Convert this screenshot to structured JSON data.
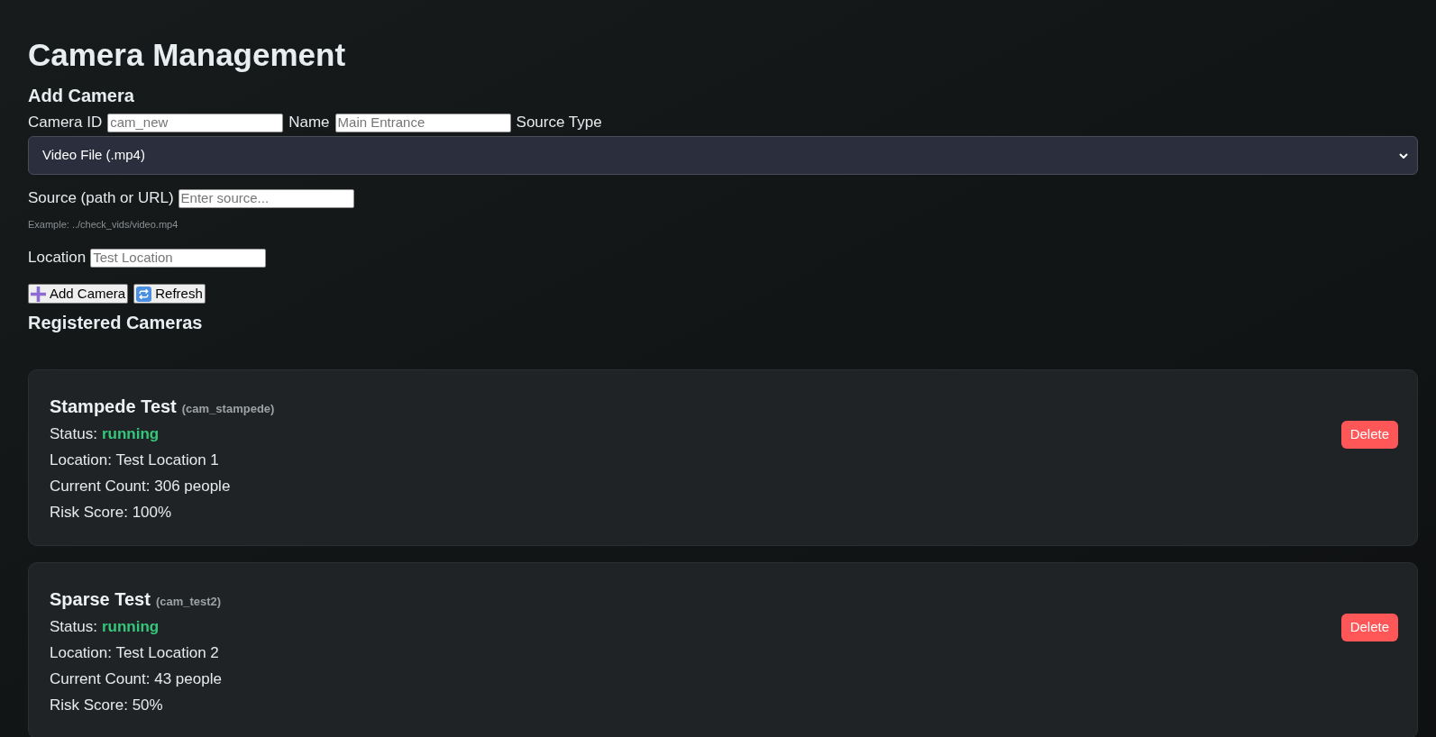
{
  "title": "Camera Management",
  "add_camera": {
    "heading": "Add Camera",
    "camera_id": {
      "label": "Camera ID",
      "placeholder": "cam_new"
    },
    "name": {
      "label": "Name",
      "placeholder": "Main Entrance"
    },
    "source_type": {
      "label": "Source Type",
      "value": "Video File (.mp4)"
    },
    "source": {
      "label": "Source (path or URL)",
      "placeholder": "Enter source...",
      "hint": "Example: ../check_vids/video.mp4"
    },
    "location": {
      "label": "Location",
      "placeholder": "Test Location"
    },
    "buttons": [
      {
        "kind": "add",
        "label": "Add Camera"
      },
      {
        "kind": "refresh",
        "label": "Refresh"
      }
    ]
  },
  "registered_cameras": {
    "heading": "Registered Cameras",
    "cameras": [
      {
        "name": "Stampede Test",
        "id": "(cam_stampede)",
        "status_label": "Status:",
        "status": "running",
        "location": "Location: Test Location 1",
        "count": "Current Count: 306 people",
        "risk": "Risk Score: 100%",
        "delete_label": "Delete"
      },
      {
        "name": "Sparse Test",
        "id": "(cam_test2)",
        "status_label": "Status:",
        "status": "running",
        "location": "Location: Test Location 2",
        "count": "Current Count: 43 people",
        "risk": "Risk Score: 50%",
        "delete_label": "Delete"
      }
    ]
  }
}
